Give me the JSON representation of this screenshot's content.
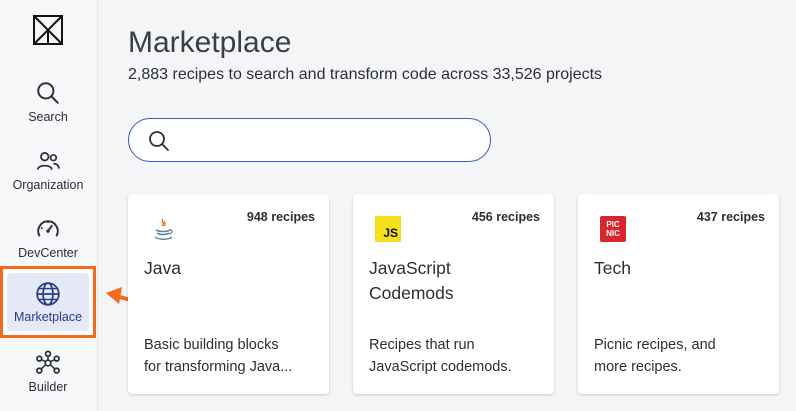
{
  "sidebar": {
    "items": [
      {
        "id": "search",
        "label": "Search",
        "icon": "search-icon"
      },
      {
        "id": "organization",
        "label": "Organization",
        "icon": "people-icon"
      },
      {
        "id": "devcenter",
        "label": "DevCenter",
        "icon": "gauge-icon"
      },
      {
        "id": "marketplace",
        "label": "Marketplace",
        "icon": "globe-icon",
        "active": true
      },
      {
        "id": "builder",
        "label": "Builder",
        "icon": "nodes-icon"
      }
    ]
  },
  "main": {
    "title": "Marketplace",
    "subtitle": "2,883 recipes to search and transform code across 33,526 projects",
    "search": {
      "value": "",
      "placeholder": ""
    },
    "cards": [
      {
        "title": "Java",
        "count": "948 recipes",
        "description_line1": "Basic building blocks",
        "description_line2": "for transforming Java...",
        "icon": "java-icon"
      },
      {
        "title_line1": "JavaScript",
        "title_line2": "Codemods",
        "count": "456 recipes",
        "description_line1": "Recipes that run",
        "description_line2": "JavaScript codemods.",
        "icon": "javascript-icon",
        "icon_text": "JS"
      },
      {
        "title": "Tech",
        "count": "437 recipes",
        "description_line1": "Picnic recipes, and",
        "description_line2": "more recipes.",
        "icon": "picnic-icon",
        "icon_text_line1": "PIC",
        "icon_text_line2": "NIC"
      }
    ]
  },
  "colors": {
    "accent": "#3b56c7",
    "highlight": "#f26b1d",
    "active_bg": "#e4e8f7"
  }
}
